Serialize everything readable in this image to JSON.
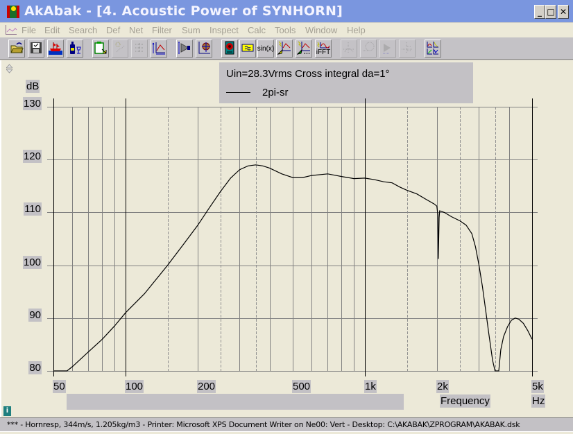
{
  "window": {
    "title": "AkAbak - [4. Acoustic Power of SYNHORN]",
    "controls": {
      "minimize": "_",
      "maximize": "□",
      "close": "✕"
    },
    "mdi_controls": {
      "minimize": "_",
      "restore": "🗗",
      "close": "✕"
    }
  },
  "menu": {
    "items": [
      "File",
      "Edit",
      "Search",
      "Def",
      "Net",
      "Filter",
      "Sum",
      "Inspect",
      "Calc",
      "Tools",
      "Window",
      "Help"
    ]
  },
  "toolbar": {
    "buttons": [
      {
        "name": "open-icon",
        "label": "",
        "enabled": true
      },
      {
        "name": "save-icon",
        "label": "",
        "enabled": true
      },
      {
        "name": "ship-icon",
        "label": "",
        "enabled": true
      },
      {
        "name": "bottle-glass-icon",
        "label": "",
        "enabled": true
      },
      {
        "name": "clipboard-icon",
        "label": "",
        "enabled": true
      },
      {
        "name": "particle-icon",
        "label": "",
        "enabled": false
      },
      {
        "name": "filter-bank-icon",
        "label": "",
        "enabled": false
      },
      {
        "name": "response-axis-icon",
        "label": "",
        "enabled": true
      },
      {
        "name": "horn-speaker-icon",
        "label": "",
        "enabled": true
      },
      {
        "name": "xy-target-icon",
        "label": "",
        "enabled": true
      },
      {
        "name": "driver-icon",
        "label": "",
        "enabled": true
      },
      {
        "name": "filter-block-icon",
        "label": "",
        "enabled": true
      },
      {
        "name": "sine-function-icon",
        "label": "sin(x)",
        "enabled": true
      },
      {
        "name": "calc-response-icon",
        "label": "",
        "enabled": true
      },
      {
        "name": "calc-response-more-icon",
        "label": "...",
        "enabled": true
      },
      {
        "name": "ifft-icon",
        "label": "iFFT",
        "enabled": true
      },
      {
        "name": "polar-plot-icon",
        "label": "",
        "enabled": false
      },
      {
        "name": "directivity-icon",
        "label": "",
        "enabled": false
      },
      {
        "name": "sonogram-icon",
        "label": "",
        "enabled": false
      },
      {
        "name": "waterfall-icon",
        "label": "",
        "enabled": false
      },
      {
        "name": "multi-chart-icon",
        "label": "",
        "enabled": true
      }
    ]
  },
  "legend": {
    "title": "Uin=28.3Vrms Cross integral da=1°",
    "series_label": "2pi-sr"
  },
  "status": {
    "text": "*** -  Hornresp, 344m/s, 1.205kg/m3 -  Printer: Microsoft XPS Document Writer on Ne00: Vert -  Desktop: C:\\AKABAK\\ZPROGRAM\\AKABAK.dsk"
  },
  "chart_data": {
    "type": "line",
    "title": "Uin=28.3Vrms Cross integral da=1°",
    "xlabel": "Frequency",
    "xunit": "Hz",
    "ylabel": "dB",
    "xscale": "log",
    "xlim": [
      50,
      5000
    ],
    "ylim": [
      80,
      130
    ],
    "grid": true,
    "legend_position": "top-center",
    "x_ticks": [
      {
        "value": 50,
        "label": "50"
      },
      {
        "value": 100,
        "label": "100"
      },
      {
        "value": 200,
        "label": "200"
      },
      {
        "value": 500,
        "label": "500"
      },
      {
        "value": 1000,
        "label": "1k"
      },
      {
        "value": 2000,
        "label": "2k"
      },
      {
        "value": 5000,
        "label": "5k"
      }
    ],
    "y_ticks": [
      {
        "value": 130,
        "label": "130"
      },
      {
        "value": 120,
        "label": "120"
      },
      {
        "value": 110,
        "label": "110"
      },
      {
        "value": 100,
        "label": "100"
      },
      {
        "value": 90,
        "label": "90"
      },
      {
        "value": 80,
        "label": "80"
      }
    ],
    "x_grid_major": [
      50,
      100,
      1000,
      5000
    ],
    "x_grid_minor": [
      60,
      70,
      80,
      90,
      200,
      300,
      400,
      500,
      600,
      700,
      800,
      900,
      2000,
      3000,
      4000
    ],
    "x_grid_dashed": [
      150,
      250,
      350,
      1500,
      2500,
      3500
    ],
    "series": [
      {
        "name": "2pi-sr",
        "color": "#000000",
        "points": [
          [
            50,
            80
          ],
          [
            57,
            80
          ],
          [
            60,
            80.8
          ],
          [
            70,
            83.6
          ],
          [
            80,
            86
          ],
          [
            90,
            88.5
          ],
          [
            100,
            91
          ],
          [
            120,
            94.6
          ],
          [
            150,
            100
          ],
          [
            175,
            104
          ],
          [
            200,
            107.5
          ],
          [
            225,
            111
          ],
          [
            250,
            114
          ],
          [
            275,
            116.5
          ],
          [
            300,
            118.1
          ],
          [
            325,
            118.8
          ],
          [
            350,
            119
          ],
          [
            375,
            118.8
          ],
          [
            400,
            118.4
          ],
          [
            450,
            117.3
          ],
          [
            500,
            116.6
          ],
          [
            550,
            116.6
          ],
          [
            600,
            117
          ],
          [
            700,
            117.3
          ],
          [
            800,
            116.8
          ],
          [
            900,
            116.4
          ],
          [
            1000,
            116.5
          ],
          [
            1100,
            116.2
          ],
          [
            1200,
            115.8
          ],
          [
            1300,
            115.6
          ],
          [
            1400,
            114.8
          ],
          [
            1500,
            114.2
          ],
          [
            1650,
            113.5
          ],
          [
            1800,
            112.5
          ],
          [
            1950,
            111.6
          ],
          [
            2000,
            111.2
          ],
          [
            2020,
            109.5
          ],
          [
            2030,
            101.2
          ],
          [
            2045,
            109
          ],
          [
            2055,
            110.3
          ],
          [
            2150,
            110
          ],
          [
            2300,
            109.2
          ],
          [
            2500,
            108.4
          ],
          [
            2650,
            107.6
          ],
          [
            2800,
            106
          ],
          [
            2900,
            103.5
          ],
          [
            3000,
            100
          ],
          [
            3100,
            96
          ],
          [
            3200,
            91.5
          ],
          [
            3300,
            87
          ],
          [
            3420,
            82
          ],
          [
            3500,
            80
          ],
          [
            3630,
            80
          ],
          [
            3700,
            84
          ],
          [
            3800,
            86.5
          ],
          [
            3950,
            88.4
          ],
          [
            4100,
            89.6
          ],
          [
            4250,
            90
          ],
          [
            4400,
            89.8
          ],
          [
            4600,
            89
          ],
          [
            4800,
            87.6
          ],
          [
            5000,
            86
          ]
        ]
      }
    ]
  }
}
